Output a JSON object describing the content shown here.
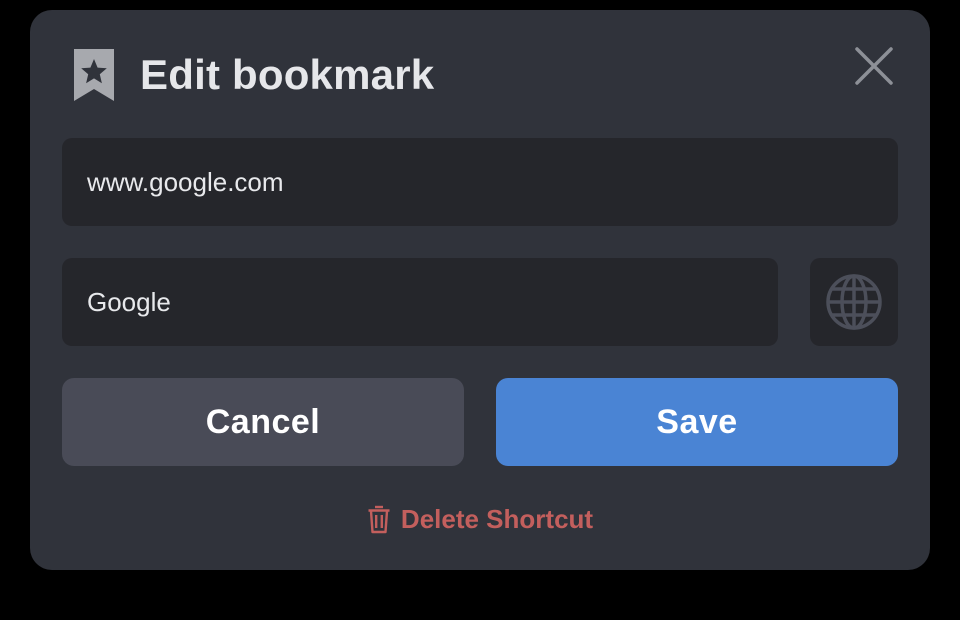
{
  "dialog": {
    "title": "Edit bookmark",
    "icons": {
      "header": "bookmark-star-icon",
      "close": "close-icon",
      "favicon": "globe-icon",
      "delete": "trash-icon"
    }
  },
  "form": {
    "url_value": "www.google.com",
    "name_value": "Google"
  },
  "actions": {
    "cancel_label": "Cancel",
    "save_label": "Save",
    "delete_label": "Delete Shortcut"
  },
  "colors": {
    "dialog_bg": "#30333b",
    "field_bg": "#25262b",
    "cancel_bg": "#494b57",
    "save_bg": "#4a84d4",
    "danger": "#c35f5d",
    "icon_gray": "#a7a9ae"
  }
}
